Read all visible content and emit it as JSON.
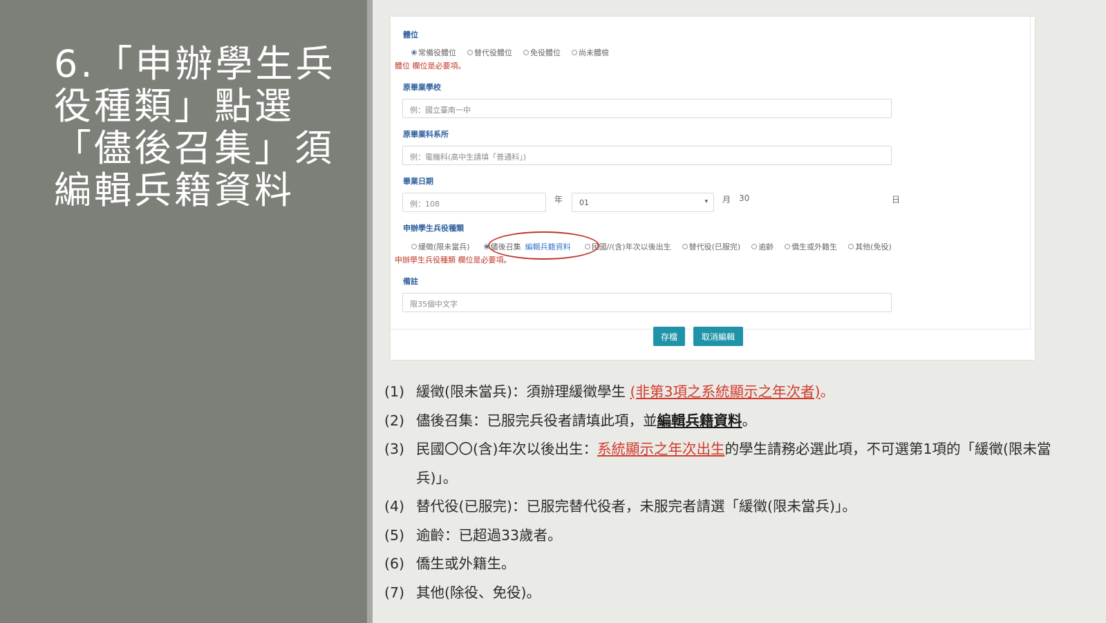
{
  "slide": {
    "title": "6.「申辦學生兵役種類」點選「儘後召集」須編輯兵籍資料"
  },
  "form": {
    "section_physical": {
      "label": "體位",
      "options": [
        "常備役體位",
        "替代役體位",
        "免役體位",
        "尚未體檢"
      ],
      "selected_index": 0,
      "error": "體位 欄位是必要項。"
    },
    "school": {
      "label": "原畢業學校",
      "placeholder": "例：國立臺南一中"
    },
    "department": {
      "label": "原畢業科系所",
      "placeholder": "例：電機科(高中生請填「普通科」)"
    },
    "grad_date": {
      "label": "畢業日期",
      "year_placeholder": "例：108",
      "year_unit": "年",
      "month_value": "01",
      "month_unit": "月",
      "day_value": "30",
      "day_unit": "日"
    },
    "service_type": {
      "label": "申辦學生兵役種類",
      "options": [
        "緩徵(限未當兵)",
        "儘後召集",
        "民國//(含)年次以後出生",
        "替代役(已服完)",
        "逾齡",
        "僑生或外籍生",
        "其他(免役)"
      ],
      "selected_index": 1,
      "edit_link": "編輯兵籍資料",
      "error": "申辦學生兵役種類 欄位是必要項。"
    },
    "remark": {
      "label": "備註",
      "placeholder": "限35個中文字"
    },
    "buttons": {
      "save": "存檔",
      "cancel": "取消編輯"
    }
  },
  "notes": [
    {
      "num": "(1)",
      "parts": [
        "緩徵(限未當兵)：須辦理緩徵學生 ",
        "(非第3項之系統顯示之年次者)",
        "。"
      ]
    },
    {
      "num": "(2)",
      "parts": [
        "儘後召集：已服完兵役者請填此項，並",
        "編輯兵籍資料",
        "。"
      ]
    },
    {
      "num": "(3)",
      "parts": [
        "民國〇〇(含)年次以後出生：",
        "系統顯示之年次出生",
        "的學生請務必選此項，不可選第1項的「緩徵(限未當兵)」。"
      ]
    },
    {
      "num": "(4)",
      "text": "替代役(已服完)：已服完替代役者，未服完者請選「緩徵(限未當兵)」。"
    },
    {
      "num": "(5)",
      "text": "逾齡：已超過33歲者。"
    },
    {
      "num": "(6)",
      "text": "僑生或外籍生。"
    },
    {
      "num": "(7)",
      "text": "其他(除役、免役)。"
    }
  ],
  "colors": {
    "left_panel": "#7c8079",
    "accent_red": "#d33a2c",
    "button": "#1f93a8",
    "label_blue": "#2e5f9c"
  }
}
